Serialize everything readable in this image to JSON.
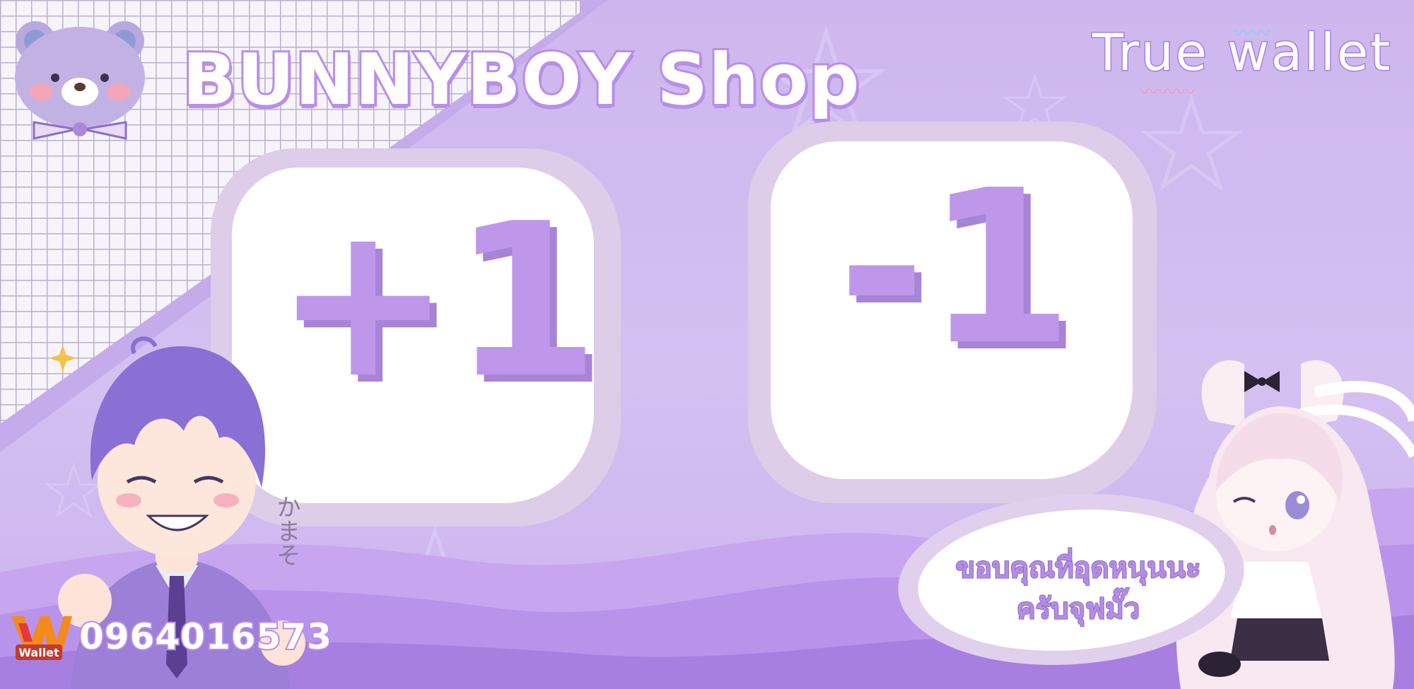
{
  "brand": {
    "title": "BUNNYBOY Shop"
  },
  "payment": {
    "title": "True wallet"
  },
  "cards": [
    {
      "label": "+1"
    },
    {
      "label": "-1"
    }
  ],
  "speech_bubble": {
    "line1": "ขอบคุณที่อุดหนุนนะ",
    "line2": "ครับจุฟมั๊ว"
  },
  "contact": {
    "phone": "0964016573",
    "wallet_logo_text": "Wallet"
  },
  "decoration": {
    "kana": "かまそ"
  },
  "colors": {
    "accent": "#be97ea",
    "accent_dark": "#a784d6",
    "background": "#cdb7ee",
    "card": "#ffffff"
  },
  "icons": [
    "bear-mascot-icon",
    "star-icon",
    "true-wallet-logo-icon",
    "boy-character-illustration",
    "bunny-girl-character-illustration"
  ]
}
